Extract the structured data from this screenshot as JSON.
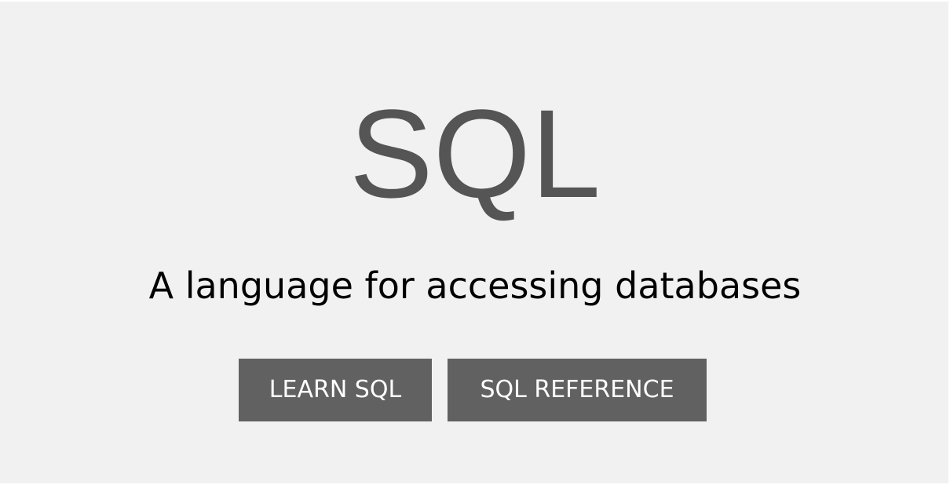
{
  "hero": {
    "title": "SQL",
    "subtitle": "A language for accessing databases",
    "buttons": [
      {
        "label": "LEARN SQL"
      },
      {
        "label": "SQL REFERENCE"
      }
    ]
  },
  "colors": {
    "background": "#f1f1f1",
    "title": "#555555",
    "subtitle": "#000000",
    "button_bg": "#616161",
    "button_text": "#ffffff"
  }
}
